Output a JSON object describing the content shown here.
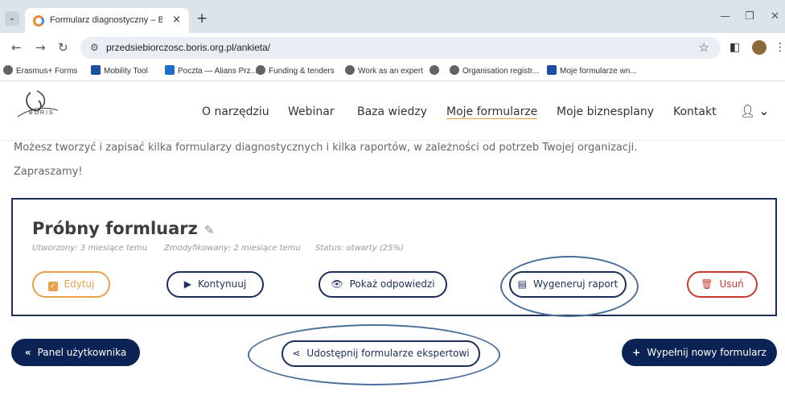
{
  "browser": {
    "tab_title": "Formularz diagnostyczny – BOR",
    "tab_close": "×",
    "new_tab": "+",
    "url": "przedsiebiorczosc.boris.org.pl/ankieta/",
    "bookmarks": [
      {
        "label": "Erasmus+ Forms"
      },
      {
        "label": "Mobility Tool"
      },
      {
        "label": "Poczta — Alians Prz..."
      },
      {
        "label": "Funding & tenders"
      },
      {
        "label": "Work as an expert"
      },
      {
        "label": ""
      },
      {
        "label": "Organisation registr..."
      },
      {
        "label": "Moje formularze wn..."
      }
    ]
  },
  "site": {
    "logo_text": "B O R I S",
    "nav": [
      {
        "label": "O narzędziu"
      },
      {
        "label": "Webinar"
      },
      {
        "label": "Baza wiedzy"
      },
      {
        "label": "Moje formularze"
      },
      {
        "label": "Moje biznesplany"
      },
      {
        "label": "Kontakt"
      }
    ]
  },
  "content": {
    "intro": "Możesz tworzyć i zapisać kilka formularzy diagnostycznych i kilka raportów, w zależności od potrzeb Twojej organizacji.",
    "welcome": "Zapraszamy!",
    "card": {
      "title": "Próbny formluarz",
      "created": "Utworzony: 3 miesiące temu",
      "modified": "Zmodyfikowany: 2 miesiące temu",
      "status": "Status: otwarty (25%)",
      "buttons": {
        "edit": "Edytuj",
        "continue": "Kontynuuj",
        "show_answers": "Pokaż odpowiedzi",
        "generate_report": "Wygeneruj raport",
        "delete": "Usuń"
      }
    },
    "bottom": {
      "panel": "Panel użytkownika",
      "share": "Udostępnij formularze ekspertowi",
      "new_form": "Wypełnij nowy formularz"
    }
  },
  "colors": {
    "navy": "#0b2354",
    "orange": "#e9a24a",
    "red": "#c9392f",
    "annotation": "#4a6f9c"
  }
}
